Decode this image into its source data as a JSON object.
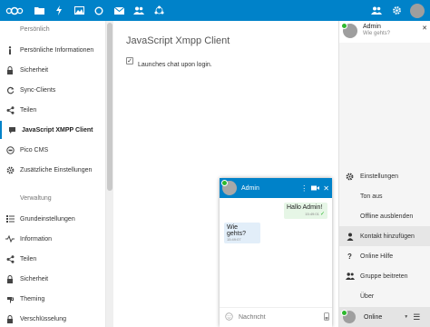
{
  "header": {
    "apps": [
      "files-icon",
      "activity-icon",
      "gallery-icon",
      "talk-icon",
      "mail-icon",
      "contacts-icon",
      "circles-icon"
    ]
  },
  "sidebar": {
    "personal_title": "Persönlich",
    "personal_items": [
      {
        "label": "Persönliche Informationen",
        "icon": "person-info-icon"
      },
      {
        "label": "Sicherheit",
        "icon": "lock-icon"
      },
      {
        "label": "Sync-Clients",
        "icon": "sync-icon"
      },
      {
        "label": "Teilen",
        "icon": "share-icon"
      },
      {
        "label": "JavaScript XMPP Client",
        "icon": "xmpp-icon"
      },
      {
        "label": "Pico CMS",
        "icon": "pico-icon"
      },
      {
        "label": "Zusätzliche Einstellungen",
        "icon": "gear-icon"
      }
    ],
    "admin_title": "Verwaltung",
    "admin_items": [
      {
        "label": "Grundeinstellungen",
        "icon": "list-icon"
      },
      {
        "label": "Information",
        "icon": "pulse-icon"
      },
      {
        "label": "Teilen",
        "icon": "share-icon"
      },
      {
        "label": "Sicherheit",
        "icon": "lock-icon"
      },
      {
        "label": "Theming",
        "icon": "palette-icon"
      },
      {
        "label": "Verschlüsselung",
        "icon": "lock-icon"
      }
    ]
  },
  "main": {
    "title": "JavaScript Xmpp Client",
    "checkbox_label": "Launches chat upon login.",
    "checkbox_checked": true
  },
  "chat": {
    "name": "Admin",
    "messages": [
      {
        "text": "Hallo Admin!",
        "time": "15:49:01",
        "outgoing": true
      },
      {
        "text": "Wie gehts?",
        "time": "15:49:07",
        "outgoing": false
      }
    ],
    "input_placeholder": "Nachricht"
  },
  "roster": {
    "user_name": "Admin",
    "user_status": "Wie gehts?",
    "menu": [
      {
        "label": "Einstellungen",
        "icon": "gear-icon"
      },
      {
        "label": "Ton aus",
        "icon": ""
      },
      {
        "label": "Offline ausblenden",
        "icon": ""
      },
      {
        "label": "Kontakt hinzufügen",
        "icon": "person-icon"
      },
      {
        "label": "Online Hilfe",
        "icon": "help-icon"
      },
      {
        "label": "Gruppe beitreten",
        "icon": "group-icon"
      },
      {
        "label": "Über",
        "icon": ""
      }
    ],
    "presence": "Online"
  },
  "colors": {
    "brand": "#0082c9",
    "online": "#2eb82e"
  }
}
